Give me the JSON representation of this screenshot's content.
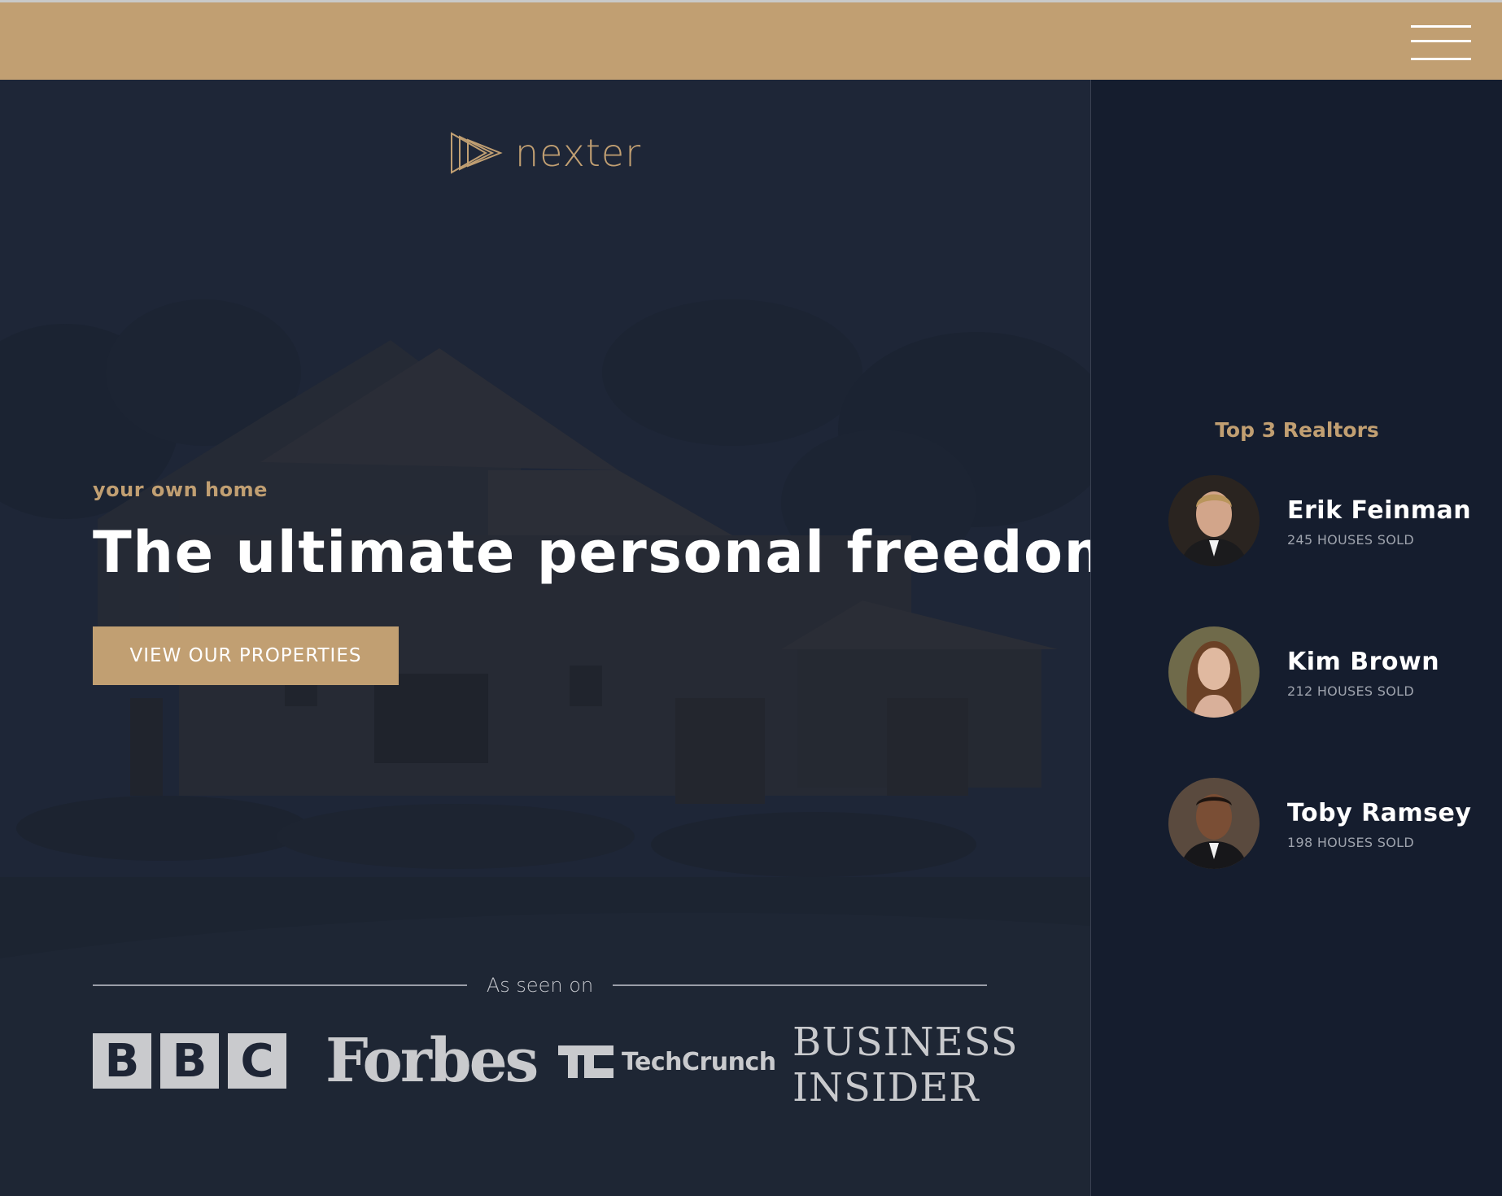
{
  "brand": {
    "name": "nexter",
    "accent_color": "#c19f72",
    "background_color": "#151d2e"
  },
  "header": {
    "menu_icon": "hamburger-menu-icon"
  },
  "hero": {
    "subtitle": "your own home",
    "headline": "The ultimate personal freedom",
    "cta_label": "VIEW OUR PROPERTIES",
    "seen_on_label": "As seen on",
    "press": {
      "bbc_letters": [
        "B",
        "B",
        "C"
      ],
      "forbes": "Forbes",
      "techcrunch": "TechCrunch",
      "business_insider_line1": "BUSINESS",
      "business_insider_line2": "INSIDER"
    }
  },
  "sidebar": {
    "title": "Top 3 Realtors",
    "realtors": [
      {
        "name": "Erik Feinman",
        "sold": "245 HOUSES SOLD"
      },
      {
        "name": "Kim Brown",
        "sold": "212 HOUSES SOLD"
      },
      {
        "name": "Toby Ramsey",
        "sold": "198 HOUSES SOLD"
      }
    ]
  }
}
